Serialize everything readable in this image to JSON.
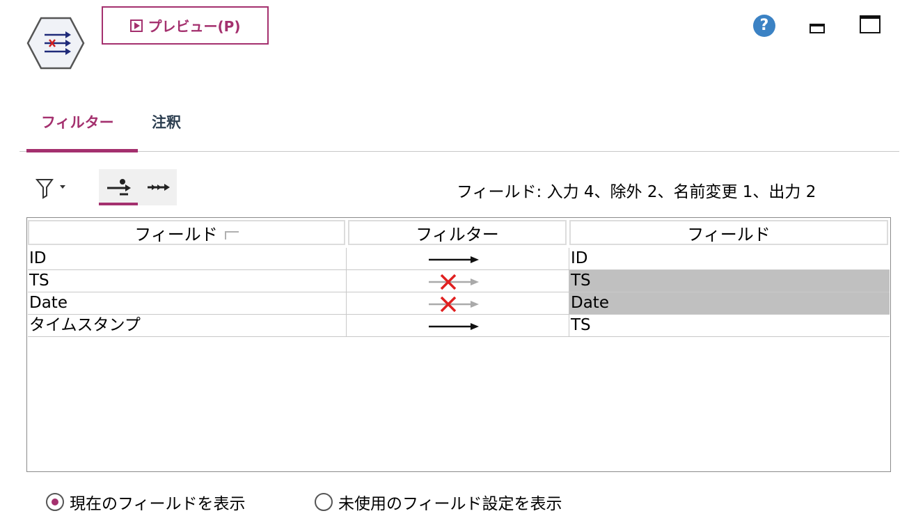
{
  "toolbar": {
    "preview_label": "プレビュー(P)",
    "help_glyph": "?"
  },
  "tabs": [
    {
      "label": "フィルター",
      "active": true
    },
    {
      "label": "注釈",
      "active": false
    }
  ],
  "field_summary": "フィールド: 入力 4、除外 2、名前変更 1、出力 2",
  "table": {
    "headers": [
      "フィールド",
      "フィルター",
      "フィールド"
    ],
    "rows": [
      {
        "input": "ID",
        "filter": "pass",
        "output": "ID"
      },
      {
        "input": "TS",
        "filter": "remove",
        "output": "TS"
      },
      {
        "input": "Date",
        "filter": "remove",
        "output": "Date"
      },
      {
        "input": "タイムスタンプ",
        "filter": "pass",
        "output": "TS"
      }
    ]
  },
  "options": [
    {
      "label": "現在のフィールドを表示",
      "selected": true
    },
    {
      "label": "未使用のフィールド設定を表示",
      "selected": false
    }
  ],
  "colors": {
    "accent": "#a4306e",
    "help": "#3b82c4",
    "removed_row": "#c0c0c0",
    "remove_x": "#e02020"
  },
  "icons": {
    "node": "filter-node-icon",
    "filter_tool": "filter-funnel-icon",
    "field_tool": "field-arrows-icon",
    "flow_tool": "flow-arrows-icon",
    "help": "help-icon",
    "minimize": "minimize-icon",
    "maximize": "maximize-icon",
    "pass": "pass-arrow-icon",
    "remove": "remove-x-icon"
  }
}
